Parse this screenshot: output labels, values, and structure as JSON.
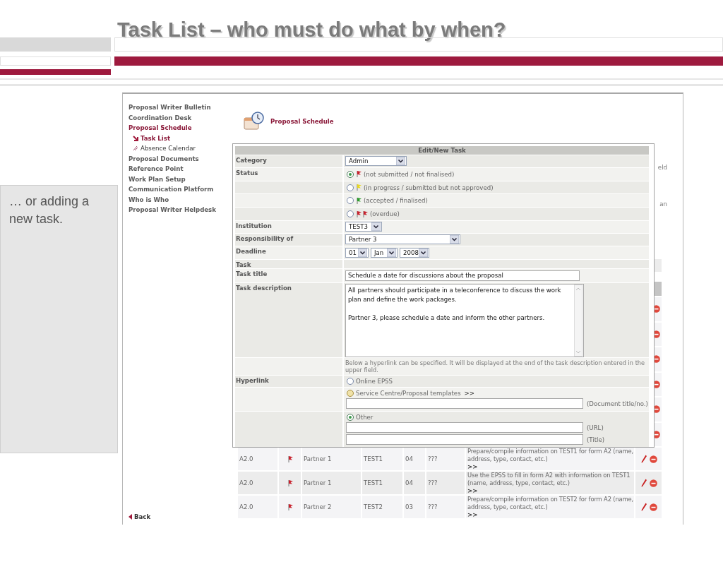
{
  "slide": {
    "title": "Task List – who must do what by when?",
    "caption": "… or adding a new task."
  },
  "nav": [
    {
      "label": "Proposal Writer Bulletin",
      "kind": "section",
      "selected": false
    },
    {
      "label": "Coordination Desk",
      "kind": "section",
      "selected": false
    },
    {
      "label": "Proposal Schedule",
      "kind": "section",
      "selected": true
    },
    {
      "label": "Task List",
      "kind": "sub",
      "selected": true
    },
    {
      "label": "Absence Calendar",
      "kind": "sub",
      "selected": false
    },
    {
      "label": "Proposal Documents",
      "kind": "section",
      "selected": false
    },
    {
      "label": "Reference Point",
      "kind": "section",
      "selected": false
    },
    {
      "label": "Work Plan Setup",
      "kind": "section",
      "selected": false
    },
    {
      "label": "Communication Platform",
      "kind": "section",
      "selected": false
    },
    {
      "label": "Who is Who",
      "kind": "section",
      "selected": false
    },
    {
      "label": "Proposal Writer Helpdesk",
      "kind": "section",
      "selected": false
    }
  ],
  "back_link": "Back",
  "page_title": "Proposal Schedule",
  "covered_fragments": [
    "eld",
    "an"
  ],
  "table": {
    "rows": [
      {
        "kind": "covered"
      },
      {
        "kind": "covered"
      },
      {
        "kind": "covered"
      },
      {
        "kind": "covered"
      },
      {
        "kind": "covered"
      },
      {
        "kind": "covered"
      },
      {
        "kind": "task",
        "code": "A2.0",
        "color": "#c8202c",
        "partner": "Partner 1",
        "institution": "TEST1",
        "number": "04",
        "column_6": "???",
        "description": "Prepare/compile information on TEST1 for form A2 (name, address, type, contact, etc.)",
        "more": ">>"
      },
      {
        "kind": "task",
        "code": "A2.0",
        "color": "#c8202c",
        "partner": "Partner 1",
        "institution": "TEST1",
        "number": "04",
        "column_6": "???",
        "description": "Use the EPSS to fill in form A2 with information on TEST1 (name, address, type, contact, etc.)",
        "more": ">>"
      },
      {
        "kind": "task",
        "code": "A2.0",
        "color": "#c8202c",
        "partner": "Partner 2",
        "institution": "TEST2",
        "number": "03",
        "column_6": "???",
        "description": "Prepare/compile information on TEST2 for form A2 (name, address, type, contact, etc.)",
        "more": ">>"
      }
    ]
  },
  "dialog": {
    "title": "Edit/New Task",
    "fields": [
      {
        "kind": "select",
        "label": "Category",
        "value": "Admin"
      },
      {
        "kind": "radio_group",
        "label": "Status",
        "options": [
          {
            "text": "(not submitted / not finalised)",
            "color": "#c8202c",
            "double": false,
            "selected": true
          },
          {
            "text": "(in progress / submitted but not approved)",
            "color": "#e8d820",
            "double": false,
            "selected": false
          },
          {
            "text": "(accepted / finalised)",
            "color": "#2a9a2a",
            "double": false,
            "selected": false
          },
          {
            "text": "(overdue)",
            "color": "#c8202c",
            "double": true,
            "selected": false
          }
        ]
      },
      {
        "kind": "select",
        "label": "Institution",
        "value": "TEST3"
      },
      {
        "kind": "select",
        "label": "Responsibility of",
        "value": "Partner 3"
      },
      {
        "kind": "date",
        "label": "Deadline",
        "parts": [
          "01",
          "Jan",
          "2008"
        ]
      },
      {
        "kind": "heading",
        "label": "Task"
      },
      {
        "kind": "text",
        "label": "Task title",
        "value": "Schedule a date for discussions about the proposal"
      },
      {
        "kind": "textarea",
        "label": "Task description",
        "paragraphs": [
          "All partners should participate in a teleconference to discuss the work plan and define the work packages.",
          "Partner 3, please schedule a date and inform the other partners."
        ]
      },
      {
        "kind": "note",
        "text": "Below a hyperlink can be specified. It will be displayed at the end of the task description entered in the upper field."
      },
      {
        "kind": "link_choice",
        "label": "Hyperlink",
        "options": [
          {
            "text": "Online EPSS",
            "selected": false,
            "highlighted": false
          },
          {
            "text": "Service Centre/Proposal templates",
            "link": ">>",
            "selected": false,
            "highlighted": true,
            "inputs": [
              {
                "suffix": "(Document title/no.)"
              }
            ]
          },
          {
            "text": "Other",
            "selected": true,
            "highlighted": false,
            "inputs": [
              {
                "suffix": "(URL)"
              },
              {
                "suffix": "(Title)"
              }
            ]
          }
        ]
      }
    ]
  }
}
